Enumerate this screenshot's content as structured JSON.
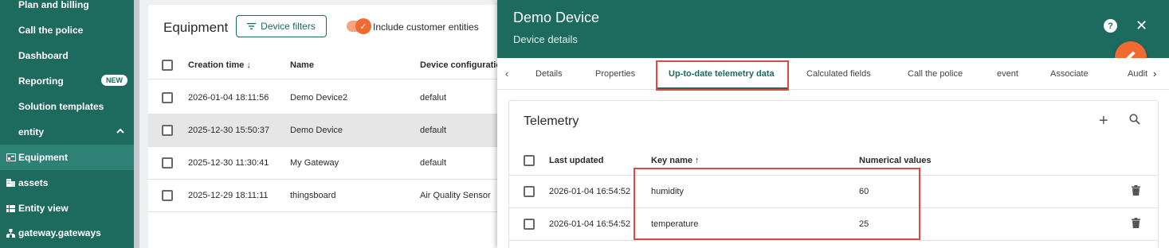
{
  "sidebar": {
    "items": [
      {
        "label": "Plan and billing",
        "icon": "billing-icon"
      },
      {
        "label": "Call the police",
        "icon": "phone-icon"
      },
      {
        "label": "Dashboard",
        "icon": "dashboard-icon"
      },
      {
        "label": "Reporting",
        "icon": "report-icon",
        "badge": "NEW"
      },
      {
        "label": "Solution templates",
        "icon": "template-icon"
      },
      {
        "label": "entity",
        "icon": "entity-icon"
      },
      {
        "label": "Equipment",
        "icon": "device-icon",
        "active": true
      },
      {
        "label": "assets",
        "icon": "assets-icon"
      },
      {
        "label": "Entity view",
        "icon": "entity-view-icon"
      },
      {
        "label": "gateway.gateways",
        "icon": "gateway-icon"
      }
    ]
  },
  "equipment": {
    "title": "Equipment",
    "filter_label": "Device filters",
    "toggle_label": "Include customer entities",
    "columns": [
      "Creation time ↓",
      "Name",
      "Device configuration"
    ],
    "rows": [
      [
        "2026-01-04 18:11:56",
        "Demo Device2",
        "defalut"
      ],
      [
        "2025-12-30 15:50:37",
        "Demo Device",
        "default"
      ],
      [
        "2025-12-30 11:30:41",
        "My Gateway",
        "default"
      ],
      [
        "2025-12-29 18:11:11",
        "thingsboard",
        "Air Quality Sensor"
      ]
    ]
  },
  "details": {
    "title": "Demo Device",
    "subtitle": "Device details",
    "tabs": [
      "Details",
      "Properties",
      "Up-to-date telemetry data",
      "Calculated fields",
      "Call the police",
      "event",
      "Associate",
      "Audit"
    ],
    "active_tab": "Up-to-date telemetry data"
  },
  "telemetry": {
    "title": "Telemetry",
    "columns": [
      "Last updated",
      "Key name ↑",
      "Numerical values"
    ],
    "rows": [
      [
        "2026-01-04 16:54:52",
        "humidity",
        "60"
      ],
      [
        "2026-01-04 16:54:52",
        "temperature",
        "25"
      ]
    ]
  },
  "colors": {
    "brand": "#1d6a5f",
    "accent": "#f06a32",
    "highlight": "#e04848"
  }
}
